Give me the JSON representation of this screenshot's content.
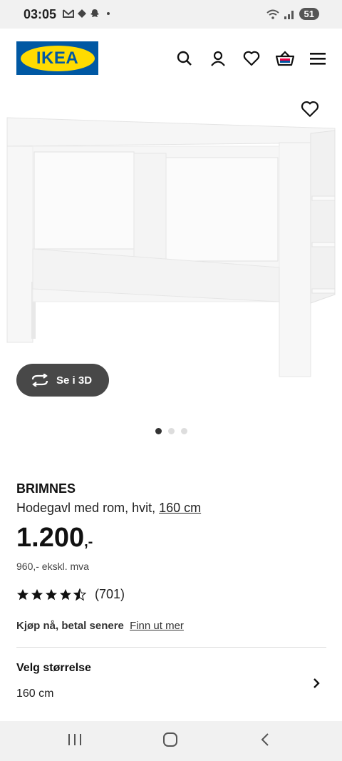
{
  "status": {
    "time": "03:05",
    "battery": "51"
  },
  "header": {
    "logo_text": "IKEA"
  },
  "hero": {
    "button_3d": "Se i 3D"
  },
  "product": {
    "brand": "BRIMNES",
    "description": "Hodegavl med rom, hvit,",
    "size_link": "160 cm",
    "price": "1.200",
    "price_suffix": ",-",
    "vat_note": "960,- ekskl. mva",
    "rating_value": 4.5,
    "rating_count": "(701)"
  },
  "klarna": {
    "text": "Kjøp nå, betal senere",
    "link": "Finn ut mer"
  },
  "size_select": {
    "title": "Velg størrelse",
    "value": "160 cm"
  },
  "icons": [
    "search-icon",
    "account-icon",
    "heart-icon",
    "basket-icon",
    "menu-icon",
    "rotate-3d-icon",
    "chevron-right-icon"
  ],
  "colors": {
    "ikea_blue": "#0058a3",
    "ikea_yellow": "#ffdb00",
    "button_dark": "#484848"
  }
}
